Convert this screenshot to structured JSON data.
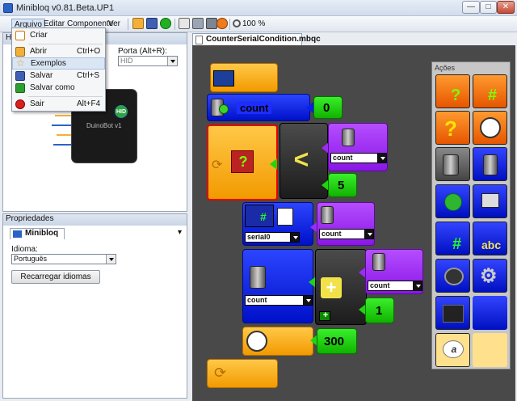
{
  "window": {
    "title": "Minibloq v0.81.Beta.UP1",
    "minimize": "—",
    "maximize": "□",
    "close": "✕"
  },
  "menubar": {
    "items": [
      "Arquivo",
      "Editar",
      "Componente",
      "Ver"
    ],
    "zoom": "100 %"
  },
  "file_menu": {
    "items": [
      {
        "label": "Criar",
        "shortcut": "",
        "icon": "new-file-icon"
      },
      {
        "label": "Abrir",
        "shortcut": "Ctrl+O",
        "icon": "open-folder-icon"
      },
      {
        "label": "Exemplos",
        "shortcut": "",
        "icon": "star-icon"
      },
      {
        "label": "Salvar",
        "shortcut": "Ctrl+S",
        "icon": "save-icon"
      },
      {
        "label": "Salvar como",
        "shortcut": "",
        "icon": "save-as-icon"
      },
      {
        "label": "Sair",
        "shortcut": "Alt+F4",
        "icon": "exit-icon"
      }
    ]
  },
  "hardware_panel": {
    "header": "Hi",
    "port_label": "Porta (Alt+R):",
    "port_value": "HID",
    "board_badge": "HID",
    "board_name": "DuinoBot v1"
  },
  "properties_panel": {
    "header": "Propriedades",
    "tab": "Minibloq",
    "close_glyph": "▾",
    "language_label": "Idioma:",
    "language_value": "Português",
    "reload_button": "Recarregar idiomas"
  },
  "editor": {
    "tab_label": "CounterSerialCondition.mbqc",
    "blocks": {
      "var_name": "count",
      "init_value": "0",
      "compare_var": "count",
      "compare_op": "<",
      "compare_value": "5",
      "serial_port": "serial0",
      "print_var": "count",
      "assign_var": "count",
      "add_op": "+",
      "add_var": "count",
      "add_value": "1",
      "delay_value": "300",
      "question_glyph": "?",
      "plus_small": "+"
    }
  },
  "palette": {
    "title": "Ações",
    "glyphs": {
      "question": "?",
      "hash": "#",
      "abc": "abc",
      "alpha": "a"
    }
  },
  "colors": {
    "block_orange": "#f7a800",
    "block_blue": "#0a1fe8",
    "block_purple": "#9b2bf5",
    "block_green": "#22d514",
    "canvas": "#494949"
  }
}
